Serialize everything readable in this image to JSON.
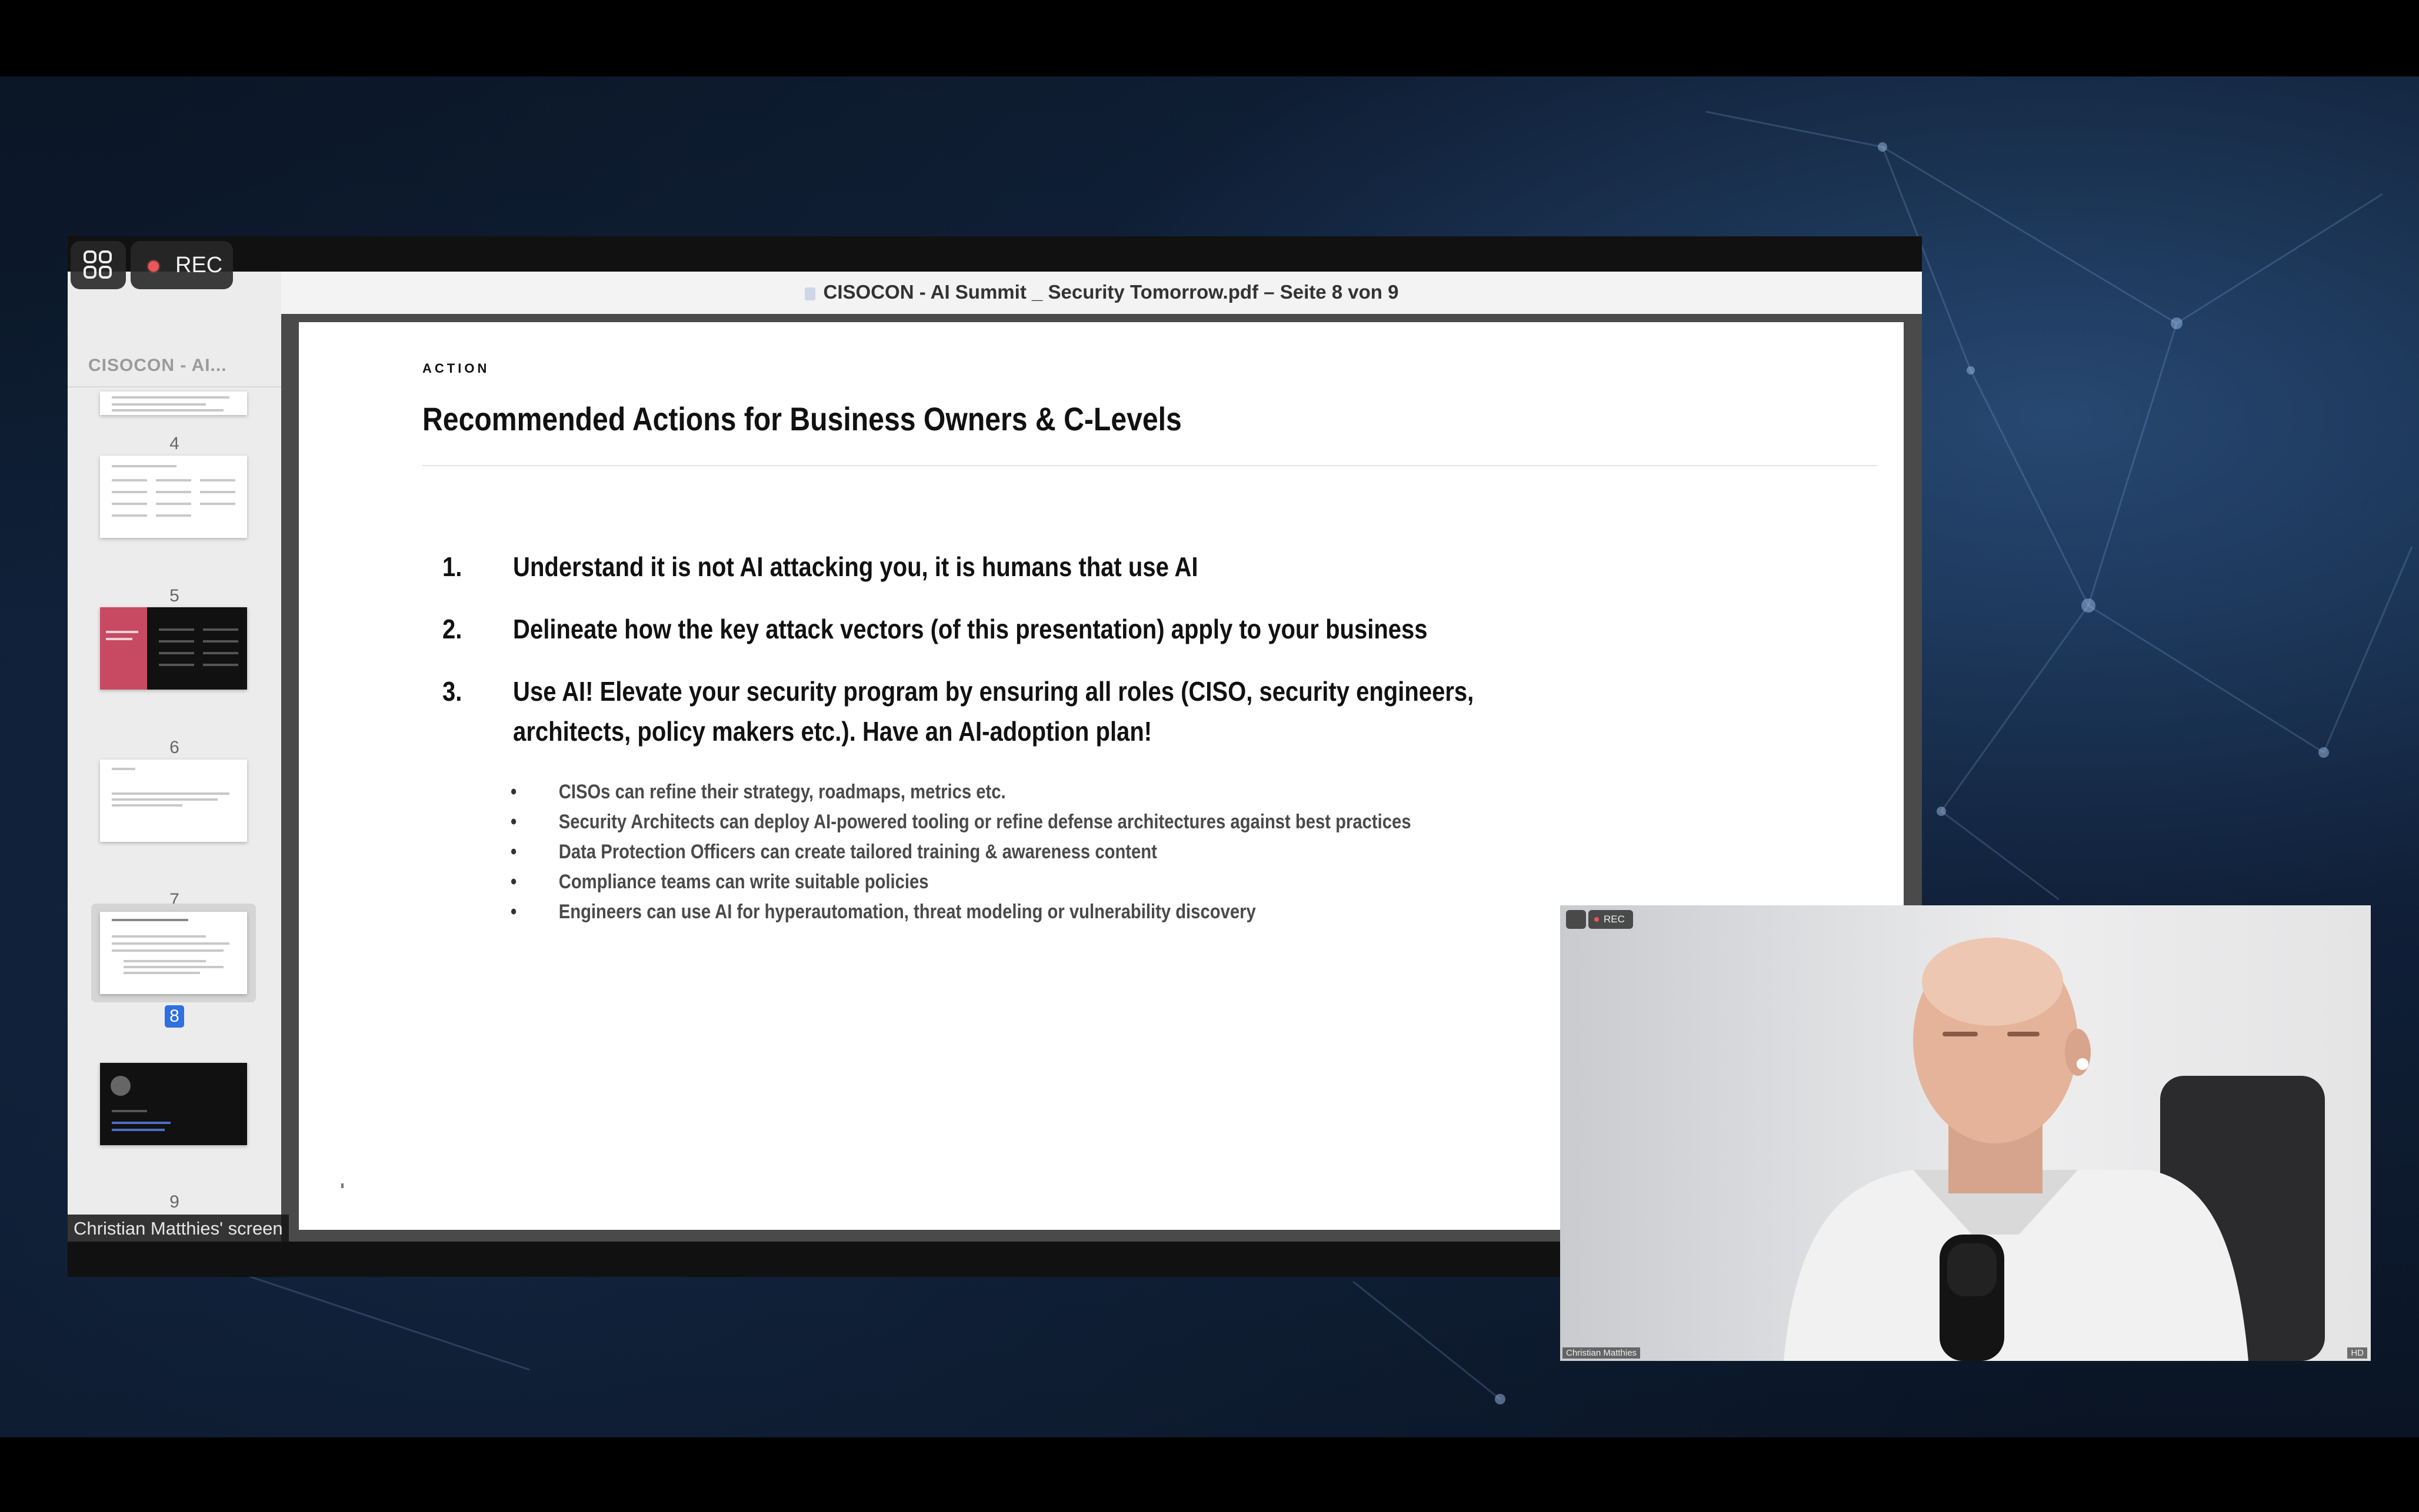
{
  "recording": {
    "rec_label": "REC"
  },
  "viewer": {
    "window_title": "CISOCON - AI Summit _ Security Tomorrow.pdf – Seite 8 von 9",
    "sidebar_title": "CISOCON - AI...",
    "thumbnails": [
      {
        "page": "4"
      },
      {
        "page": "5"
      },
      {
        "page": "6"
      },
      {
        "page": "7"
      },
      {
        "page": "8",
        "selected": true
      },
      {
        "page": "9"
      }
    ]
  },
  "slide": {
    "kicker": "ACTION",
    "title": "Recommended Actions for Business Owners & C-Levels",
    "items": [
      {
        "num": "1.",
        "text": "Understand it is not AI attacking you, it is humans that use AI"
      },
      {
        "num": "2.",
        "text": "Delineate how the key attack vectors (of this presentation) apply to your business"
      },
      {
        "num": "3.",
        "text": "Use AI! Elevate your security program by ensuring all roles (CISO, security engineers,",
        "text_cont": "architects, policy makers etc.). Have an AI-adoption plan!"
      }
    ],
    "bullets": [
      "CISOs can refine their strategy, roadmaps, metrics etc.",
      "Security Architects can deploy AI-powered tooling or refine defense architectures against best practices",
      "Data Protection Officers can create tailored training & awareness content",
      "Compliance teams can write suitable policies",
      "Engineers can use AI for hyperautomation, threat modeling or vulnerability discovery"
    ]
  },
  "share_label": "Christian Matthies' screen",
  "webcam": {
    "rec_label": "REC",
    "name": "Christian Matthies",
    "quality": "HD"
  }
}
